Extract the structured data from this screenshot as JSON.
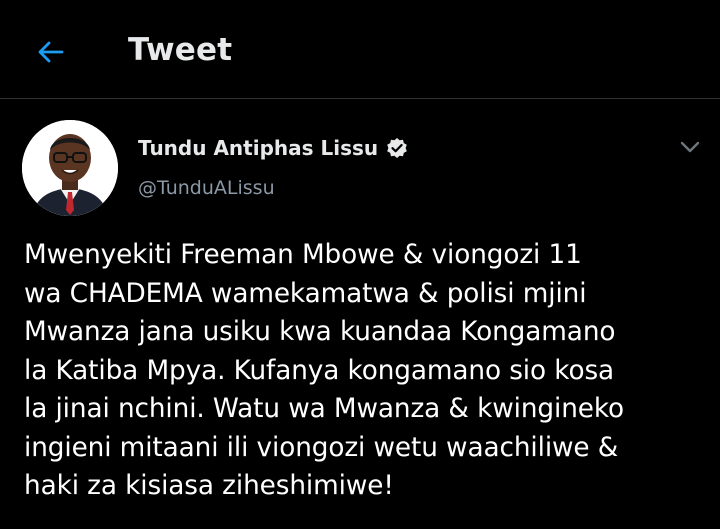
{
  "header": {
    "title": "Tweet",
    "back_icon": "arrow-left-icon",
    "accent_color": "#1d9bf0"
  },
  "tweet": {
    "author_name": "Tundu Antiphas Lissu",
    "author_handle": "@TunduALissu",
    "verified_icon": "verified-badge-icon",
    "more_icon": "chevron-down-icon",
    "text": "Mwenyekiti Freeman Mbowe & viongozi 11\nwa CHADEMA wamekamatwa & polisi mjini\nMwanza jana usiku kwa kuandaa Kongamano\nla Katiba Mpya. Kufanya kongamano sio kosa\nla jinai nchini. Watu wa Mwanza & kwingineko\ningieni mitaani ili viongozi wetu waachiliwe &\nhaki za kisiasa ziheshimiwe!"
  },
  "colors": {
    "background": "#000000",
    "primary_text": "#e7e9ea",
    "secondary_text": "#8b98a5",
    "divider": "#2f3336"
  }
}
